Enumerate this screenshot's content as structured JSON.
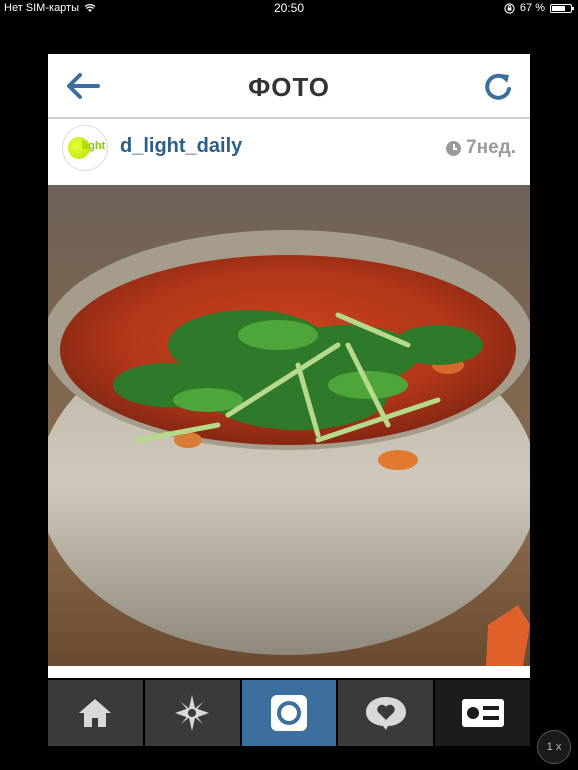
{
  "status_bar": {
    "carrier": "Нет SIM-карты",
    "time": "20:50",
    "battery": "67 %",
    "battery_level": 0.67
  },
  "nav": {
    "title": "ФОТО",
    "back_icon": "arrow-left-icon",
    "refresh_icon": "refresh-icon"
  },
  "post": {
    "avatar_text": "light",
    "username": "d_light_daily",
    "time_ago": "7нед.",
    "time_icon": "clock-icon"
  },
  "tabs": [
    {
      "icon": "home-icon"
    },
    {
      "icon": "explore-star-icon"
    },
    {
      "icon": "camera-icon"
    },
    {
      "icon": "activity-heart-icon"
    },
    {
      "icon": "profile-card-icon"
    }
  ],
  "zoom": {
    "label": "1 x"
  },
  "colors": {
    "accent": "#2c5e8a",
    "active_tab": "#3d6f9e"
  }
}
